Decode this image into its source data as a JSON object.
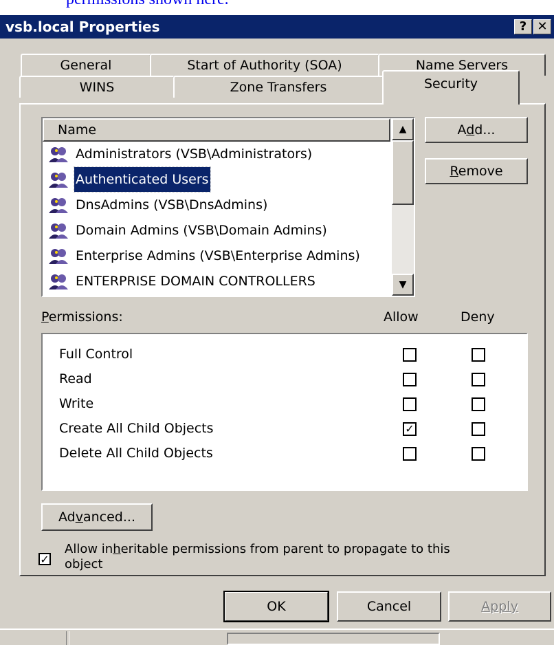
{
  "caption": "permissions shown here.",
  "window": {
    "title": "vsb.local Properties",
    "help_glyph": "?",
    "close_glyph": "✕"
  },
  "tabs": {
    "row1": [
      "General",
      "Start of Authority (SOA)",
      "Name Servers"
    ],
    "row2": [
      "WINS",
      "Zone Transfers",
      "Security"
    ],
    "active": "Security"
  },
  "names_list": {
    "header": "Name",
    "items": [
      {
        "label": "Administrators (VSB\\Administrators)",
        "icon": "user-group-icon"
      },
      {
        "label": "Authenticated Users",
        "icon": "user-group-icon",
        "selected": true
      },
      {
        "label": "DnsAdmins (VSB\\DnsAdmins)",
        "icon": "user-group-icon"
      },
      {
        "label": "Domain Admins (VSB\\Domain Admins)",
        "icon": "user-group-icon"
      },
      {
        "label": "Enterprise Admins (VSB\\Enterprise Admins)",
        "icon": "user-group-icon"
      },
      {
        "label": "ENTERPRISE DOMAIN CONTROLLERS",
        "icon": "user-group-icon"
      }
    ]
  },
  "buttons": {
    "add": {
      "pre": "A",
      "key": "d",
      "post": "d..."
    },
    "remove": {
      "pre": "",
      "key": "R",
      "post": "emove"
    },
    "advanced": {
      "pre": "Ad",
      "key": "v",
      "post": "anced..."
    },
    "ok": "OK",
    "cancel": "Cancel",
    "apply": "Apply"
  },
  "permissions": {
    "label_pre": "",
    "label_key": "P",
    "label_post": "ermissions:",
    "allow_header": "Allow",
    "deny_header": "Deny",
    "rows": [
      {
        "name": "Full Control",
        "allow": false,
        "deny": false
      },
      {
        "name": "Read",
        "allow": false,
        "deny": false
      },
      {
        "name": "Write",
        "allow": false,
        "deny": false
      },
      {
        "name": "Create All Child Objects",
        "allow": true,
        "deny": false
      },
      {
        "name": "Delete All Child Objects",
        "allow": false,
        "deny": false
      }
    ]
  },
  "inherit": {
    "checked": true,
    "line1_pre": "Allow in",
    "line1_key": "h",
    "line1_post": "eritable permissions from parent to propagate to this",
    "line2": "object"
  },
  "colors": {
    "titlebar": "#0a246a",
    "dialog": "#d4d0c8",
    "selection": "#0a246a",
    "caption_link": "#0000ee"
  }
}
